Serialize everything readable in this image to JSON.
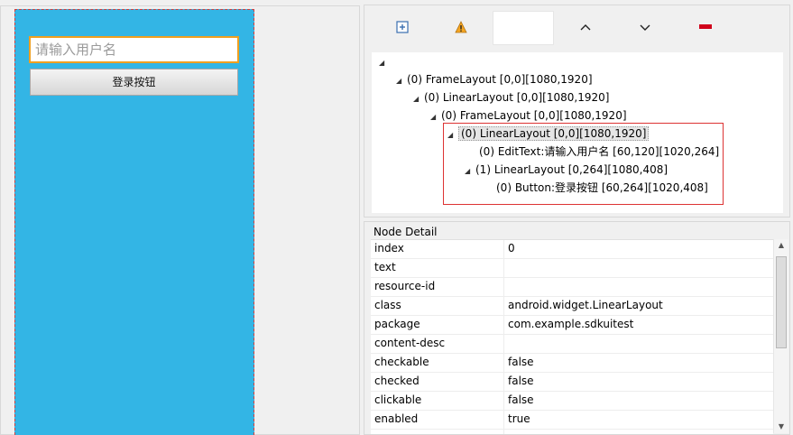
{
  "device": {
    "edit_placeholder": "请输入用户名",
    "button_label": "登录按钮"
  },
  "toolbar": {
    "icons": [
      "expand-all-icon",
      "warning-icon",
      "up-icon",
      "down-icon",
      "remove-icon"
    ],
    "up_glyph": "⌃",
    "down_glyph": "⌄"
  },
  "tree": {
    "nodes": [
      {
        "label": ""
      },
      {
        "label": "(0) FrameLayout [0,0][1080,1920]"
      },
      {
        "label": "(0) LinearLayout [0,0][1080,1920]"
      },
      {
        "label": "(0) FrameLayout [0,0][1080,1920]"
      },
      {
        "label": "(0) LinearLayout [0,0][1080,1920]"
      },
      {
        "label": "(0) EditText:请输入用户名 [60,120][1020,264]"
      },
      {
        "label": "(1) LinearLayout [0,264][1080,408]"
      },
      {
        "label": "(0) Button:登录按钮 [60,264][1020,408]"
      }
    ]
  },
  "node_detail": {
    "title": "Node Detail",
    "rows": [
      {
        "key": "index",
        "value": "0"
      },
      {
        "key": "text",
        "value": ""
      },
      {
        "key": "resource-id",
        "value": ""
      },
      {
        "key": "class",
        "value": "android.widget.LinearLayout"
      },
      {
        "key": "package",
        "value": "com.example.sdkuitest"
      },
      {
        "key": "content-desc",
        "value": ""
      },
      {
        "key": "checkable",
        "value": "false"
      },
      {
        "key": "checked",
        "value": "false"
      },
      {
        "key": "clickable",
        "value": "false"
      },
      {
        "key": "enabled",
        "value": "true"
      }
    ]
  },
  "colors": {
    "device_bg": "#33b5e5",
    "edit_focus": "#f0a020",
    "selection_border": "#dd3333",
    "remove_red": "#d0021b"
  }
}
